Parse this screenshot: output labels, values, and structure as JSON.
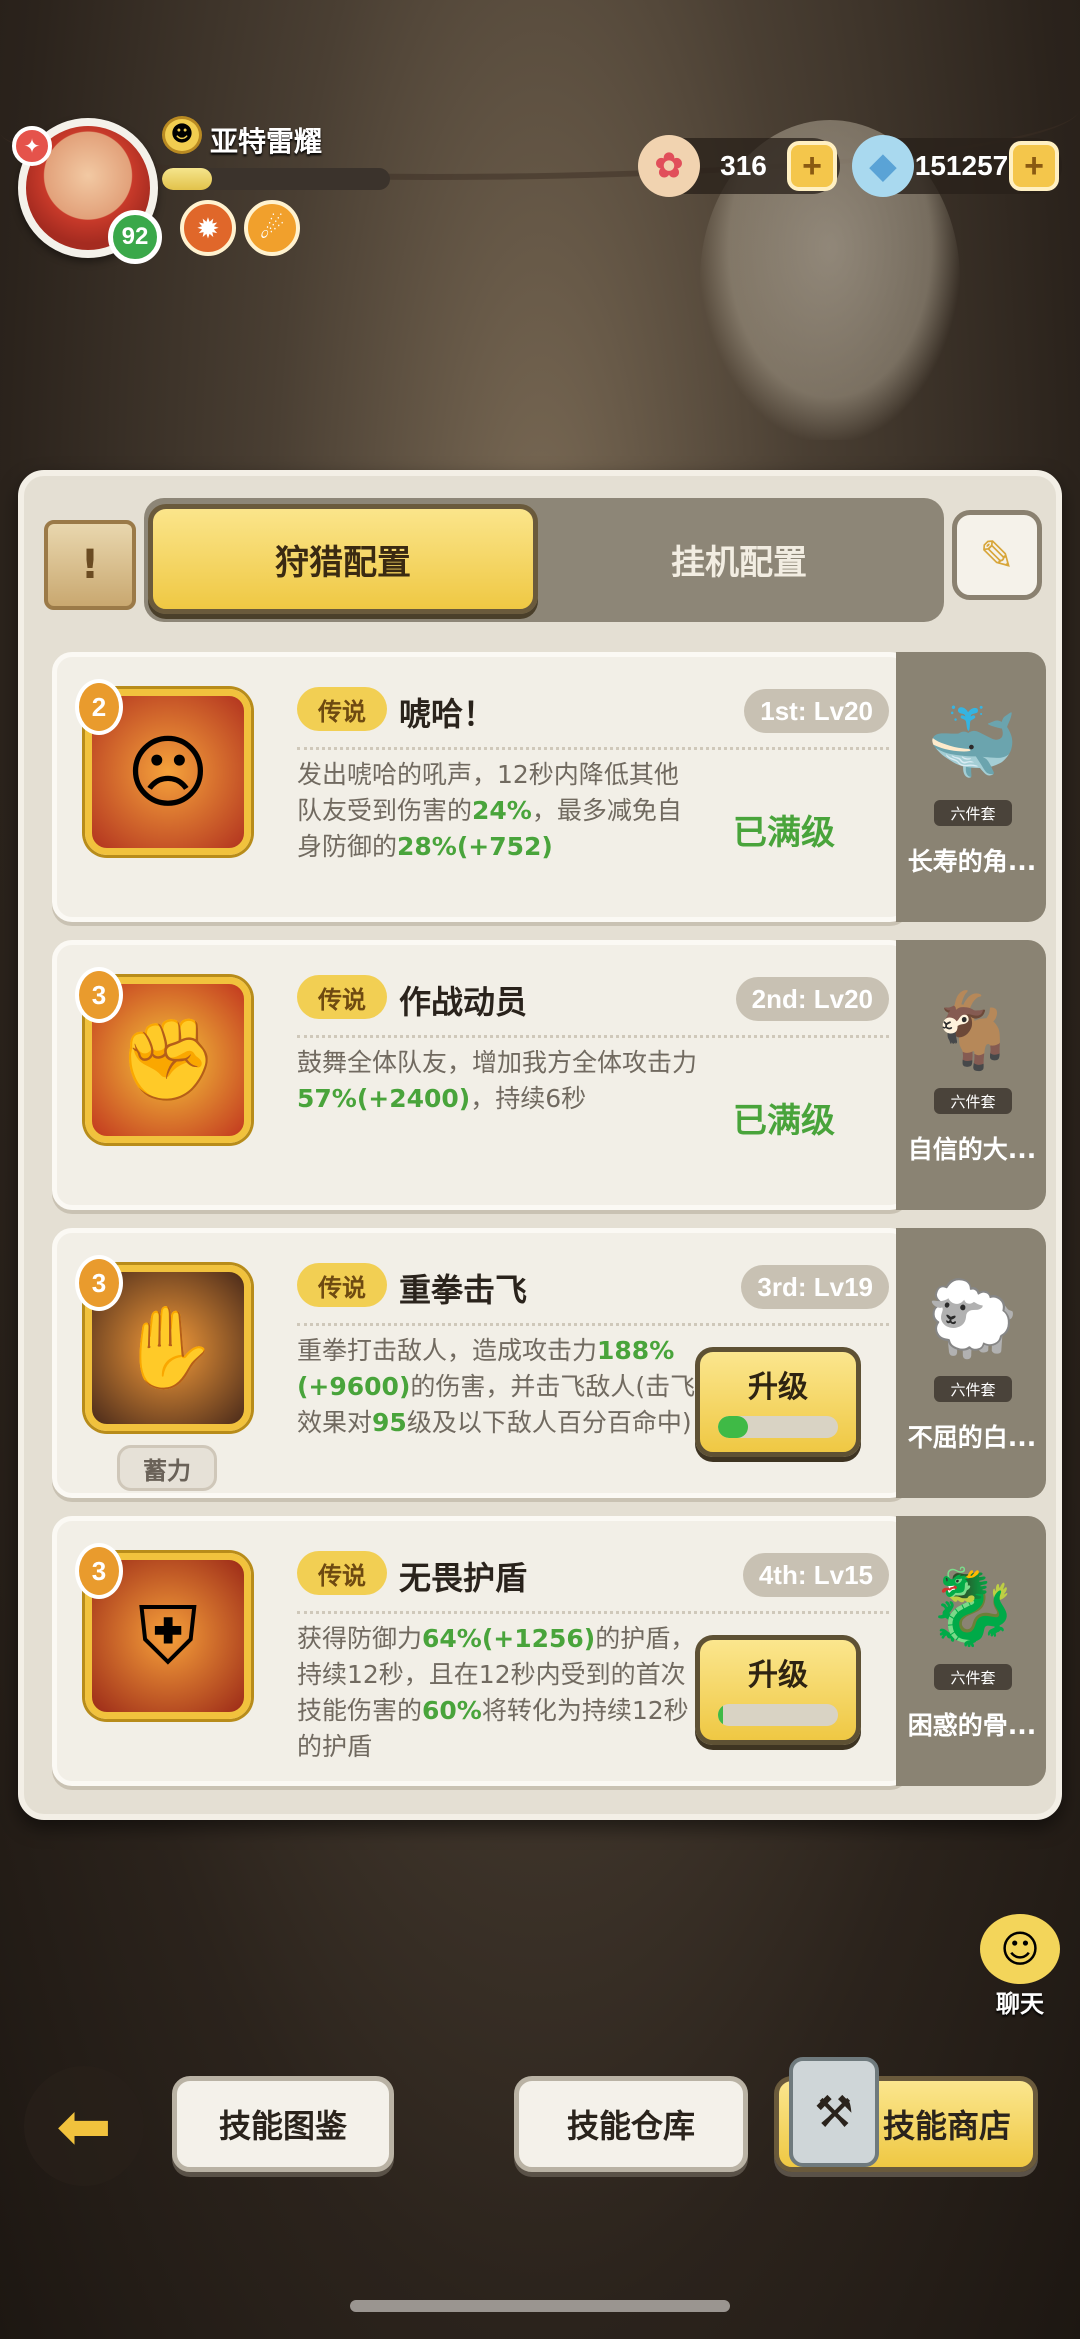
{
  "player": {
    "name": "亚特雷耀",
    "level": "92",
    "exp_fraction": 0.22
  },
  "currency": [
    {
      "icon": "shell-coin-icon",
      "value": "316"
    },
    {
      "icon": "crystal-gem-icon",
      "value": "151257"
    }
  ],
  "tabs": {
    "active": "狩猎配置",
    "inactive": "挂机配置"
  },
  "skills": [
    {
      "rank": "2",
      "tag": "传说",
      "name": "唬哈！",
      "level": "1st: Lv20",
      "desc": [
        "发出唬哈的吼声，12秒内降低其他队友受到伤害的",
        "24%",
        "，最多减免自身防御的",
        "28%(+752)"
      ],
      "status": "已满级"
    },
    {
      "rank": "3",
      "tag": "传说",
      "name": "作战动员",
      "level": "2nd: Lv20",
      "desc": [
        "鼓舞全体队友，增加我方全体攻击力",
        "57%(+2400)",
        "，持续6秒",
        ""
      ],
      "status": "已满级"
    },
    {
      "rank": "3",
      "tag": "传说",
      "name": "重拳击飞",
      "level": "3rd: Lv19",
      "desc": [
        "重拳打击敌人，造成攻击力",
        "188%(+9600)",
        "的伤害，并击飞敌人(击飞效果对",
        "95",
        "级及以下敌人百分百命中)"
      ],
      "button": "升级",
      "progress": 0.25,
      "extra_tag": "蓄力"
    },
    {
      "rank": "3",
      "tag": "传说",
      "name": "无畏护盾",
      "level": "4th: Lv15",
      "desc": [
        "获得防御力",
        "64%(+1256)",
        "的护盾，持续12秒，且在12秒内受到的首次技能伤害的",
        "60%",
        "将转化为持续12秒的护盾"
      ],
      "button": "升级",
      "progress": 0.04
    }
  ],
  "pets": [
    {
      "name": "长寿的角...",
      "set": "六件套",
      "icon": "whale-pet-icon"
    },
    {
      "name": "自信的大...",
      "set": "六件套",
      "icon": "goat-pet-icon"
    },
    {
      "name": "不屈的白...",
      "set": "六件套",
      "icon": "white-goat-pet-icon"
    },
    {
      "name": "困惑的骨...",
      "set": "六件套",
      "icon": "bone-dragon-pet-icon"
    }
  ],
  "chat": {
    "label": "聊天"
  },
  "bottom": {
    "codex": "技能图鉴",
    "warehouse": "技能仓库",
    "shop": "技能商店"
  }
}
